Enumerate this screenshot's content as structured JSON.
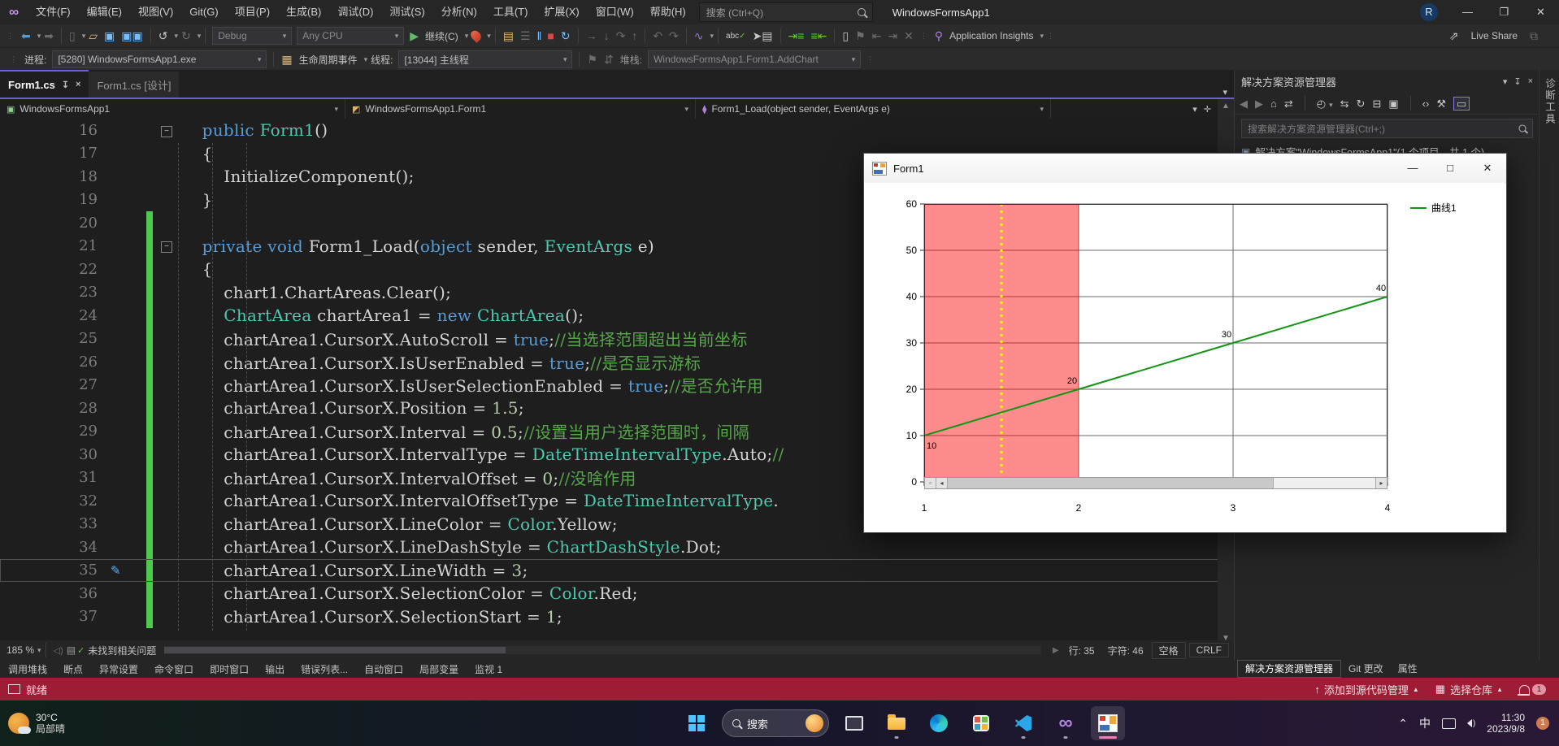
{
  "icons": {
    "grip": "⋮⋮",
    "back": "◀",
    "forward": "▶",
    "caret-down": "▾",
    "caret-up": "▲",
    "new-file": "▯",
    "open-folder": "▱",
    "save": "▭",
    "save-all": "▭▭",
    "undo": "↺",
    "redo": "↻",
    "play": "▶",
    "pause": "‖",
    "stop": "■",
    "restart": "↻",
    "step-over": "↷",
    "step-into": "↓",
    "step-out": "↑",
    "chart": "∿",
    "abc": "abc",
    "pointer": "➤",
    "indent": "⇥",
    "outdent": "⇤",
    "bookmark": "⚑",
    "bulb": "⚲",
    "home": "⌂",
    "sync": "⇄",
    "clock": "◴",
    "swap": "⇆",
    "refresh": "↻",
    "collapse": "⊟",
    "copy-docs": "▣",
    "code-brackets": "‹›",
    "wrench": "⚒",
    "scope": "▭",
    "pin": "↧",
    "close": "×",
    "minimize": "—",
    "maximize": "□",
    "restore": "❐",
    "split": "✛",
    "more": "⋮",
    "dots": "…",
    "fold-minus": "−",
    "pen": "✎",
    "up-arrow": "↑",
    "repo": "▦",
    "flag": "⚑",
    "list": "≣",
    "speaker": "◁)",
    "doc": "▤",
    "check": "✓",
    "left-small": "◂",
    "right-small": "▸",
    "reset-zoom": "▫",
    "chevron-up": "⌃",
    "ime": "中"
  },
  "titlebar": {
    "menus": [
      "文件(F)",
      "编辑(E)",
      "视图(V)",
      "Git(G)",
      "项目(P)",
      "生成(B)",
      "调试(D)",
      "测试(S)",
      "分析(N)",
      "工具(T)",
      "扩展(X)",
      "窗口(W)",
      "帮助(H)"
    ],
    "search_placeholder": "搜索 (Ctrl+Q)",
    "app_title": "WindowsFormsApp1",
    "avatar": "R",
    "minimize": "—",
    "restore": "❐",
    "close": "✕"
  },
  "toolbar": {
    "config": "Debug",
    "platform": "Any CPU",
    "continue_label": "继续(C)",
    "appinsights_label": "Application Insights"
  },
  "debugbar": {
    "process_label": "进程:",
    "process_value": "[5280] WindowsFormsApp1.exe",
    "lifecycle_label": "生命周期事件",
    "thread_label": "线程:",
    "thread_value": "[13044] 主线程",
    "stack_label": "堆栈:",
    "stack_value": "WindowsFormsApp1.Form1.AddChart"
  },
  "tabs": [
    {
      "label": "Form1.cs",
      "active": true
    },
    {
      "label": "Form1.cs [设计]",
      "active": false
    }
  ],
  "navbar": {
    "project": "WindowsFormsApp1",
    "type": "WindowsFormsApp1.Form1",
    "member": "Form1_Load(object sender, EventArgs e)"
  },
  "code": {
    "lines": [
      {
        "n": 16,
        "fold": true,
        "chg": false,
        "tokens": [
          [
            "p",
            "    "
          ],
          [
            "k",
            "public"
          ],
          [
            "p",
            " "
          ],
          [
            "t",
            "Form1"
          ],
          [
            "p",
            "()"
          ]
        ]
      },
      {
        "n": 17,
        "tokens": [
          [
            "p",
            "    {"
          ]
        ]
      },
      {
        "n": 18,
        "tokens": [
          [
            "p",
            "        InitializeComponent();"
          ]
        ]
      },
      {
        "n": 19,
        "tokens": [
          [
            "p",
            "    }"
          ]
        ]
      },
      {
        "n": 20,
        "chg": true,
        "tokens": []
      },
      {
        "n": 21,
        "fold": true,
        "chg": true,
        "tokens": [
          [
            "p",
            "    "
          ],
          [
            "k",
            "private"
          ],
          [
            "p",
            " "
          ],
          [
            "k",
            "void"
          ],
          [
            "p",
            " Form1_Load("
          ],
          [
            "k",
            "object"
          ],
          [
            "p",
            " sender, "
          ],
          [
            "t",
            "EventArgs"
          ],
          [
            "p",
            " e)"
          ]
        ]
      },
      {
        "n": 22,
        "chg": true,
        "tokens": [
          [
            "p",
            "    {"
          ]
        ]
      },
      {
        "n": 23,
        "chg": true,
        "tokens": [
          [
            "p",
            "        chart1.ChartAreas.Clear();"
          ]
        ]
      },
      {
        "n": 24,
        "chg": true,
        "tokens": [
          [
            "p",
            "        "
          ],
          [
            "t",
            "ChartArea"
          ],
          [
            "p",
            " chartArea1 = "
          ],
          [
            "k",
            "new"
          ],
          [
            "p",
            " "
          ],
          [
            "t",
            "ChartArea"
          ],
          [
            "p",
            "();"
          ]
        ]
      },
      {
        "n": 25,
        "chg": true,
        "tokens": [
          [
            "p",
            "        chartArea1.CursorX.AutoScroll = "
          ],
          [
            "k",
            "true"
          ],
          [
            "p",
            ";"
          ],
          [
            "c",
            "//当选择范围超出当前坐标"
          ]
        ]
      },
      {
        "n": 26,
        "chg": true,
        "tokens": [
          [
            "p",
            "        chartArea1.CursorX.IsUserEnabled = "
          ],
          [
            "k",
            "true"
          ],
          [
            "p",
            ";"
          ],
          [
            "c",
            "//是否显示游标"
          ]
        ]
      },
      {
        "n": 27,
        "chg": true,
        "tokens": [
          [
            "p",
            "        chartArea1.CursorX.IsUserSelectionEnabled = "
          ],
          [
            "k",
            "true"
          ],
          [
            "p",
            ";"
          ],
          [
            "c",
            "//是否允许用"
          ]
        ]
      },
      {
        "n": 28,
        "chg": true,
        "tokens": [
          [
            "p",
            "        chartArea1.CursorX.Position = "
          ],
          [
            "n",
            "1.5"
          ],
          [
            "p",
            ";"
          ]
        ]
      },
      {
        "n": 29,
        "chg": true,
        "tokens": [
          [
            "p",
            "        chartArea1.CursorX.Interval = "
          ],
          [
            "n",
            "0.5"
          ],
          [
            "p",
            ";"
          ],
          [
            "c",
            "//设置当用户选择范围时，间隔"
          ]
        ]
      },
      {
        "n": 30,
        "chg": true,
        "tokens": [
          [
            "p",
            "        chartArea1.CursorX.IntervalType = "
          ],
          [
            "t",
            "DateTimeIntervalType"
          ],
          [
            "p",
            ".Auto;"
          ],
          [
            "c",
            "//"
          ]
        ]
      },
      {
        "n": 31,
        "chg": true,
        "tokens": [
          [
            "p",
            "        chartArea1.CursorX.IntervalOffset = "
          ],
          [
            "n",
            "0"
          ],
          [
            "p",
            ";"
          ],
          [
            "c",
            "//没啥作用"
          ]
        ]
      },
      {
        "n": 32,
        "chg": true,
        "tokens": [
          [
            "p",
            "        chartArea1.CursorX.IntervalOffsetType = "
          ],
          [
            "t",
            "DateTimeIntervalType"
          ],
          [
            "p",
            "."
          ]
        ]
      },
      {
        "n": 33,
        "chg": true,
        "tokens": [
          [
            "p",
            "        chartArea1.CursorX.LineColor = "
          ],
          [
            "t",
            "Color"
          ],
          [
            "p",
            ".Yellow;"
          ]
        ]
      },
      {
        "n": 34,
        "chg": true,
        "tokens": [
          [
            "p",
            "        chartArea1.CursorX.LineDashStyle = "
          ],
          [
            "t",
            "ChartDashStyle"
          ],
          [
            "p",
            ".Dot;"
          ]
        ]
      },
      {
        "n": 35,
        "chg": true,
        "cur": true,
        "pen": true,
        "tokens": [
          [
            "p",
            "        chartArea1.CursorX.LineWidth = "
          ],
          [
            "n",
            "3"
          ],
          [
            "p",
            ";"
          ]
        ]
      },
      {
        "n": 36,
        "chg": true,
        "tokens": [
          [
            "p",
            "        chartArea1.CursorX.SelectionColor = "
          ],
          [
            "t",
            "Color"
          ],
          [
            "p",
            ".Red;"
          ]
        ]
      },
      {
        "n": 37,
        "chg": true,
        "tokens": [
          [
            "p",
            "        chartArea1.CursorX.SelectionStart = "
          ],
          [
            "n",
            "1"
          ],
          [
            "p",
            ";"
          ]
        ]
      }
    ]
  },
  "editor_status": {
    "zoom": "185 %",
    "health": "未找到相关问题",
    "line": "行: 35",
    "char": "字符: 46",
    "space": "空格",
    "eol": "CRLF"
  },
  "bottom_tabs": [
    "调用堆栈",
    "断点",
    "异常设置",
    "命令窗口",
    "即时窗口",
    "输出",
    "错误列表...",
    "自动窗口",
    "局部变量",
    "监视 1"
  ],
  "solution_explorer": {
    "title": "解决方案资源管理器",
    "search_placeholder": "搜索解决方案资源管理器(Ctrl+;)",
    "root_item": "解决方案\"WindowsFormsApp1\"(1 个项目，共 1 个)",
    "bottom_tabs": [
      {
        "label": "解决方案资源管理器",
        "active": true
      },
      {
        "label": "Git 更改",
        "active": false
      },
      {
        "label": "属性",
        "active": false
      }
    ]
  },
  "right_strip": {
    "vertical_tab": "诊断工具"
  },
  "statusbar": {
    "ready": "就绪",
    "add_source_control": "添加到源代码管理",
    "select_repo": "选择仓库",
    "bell_badge": "1"
  },
  "form1": {
    "title": "Form1",
    "minimize": "—",
    "maximize": "□",
    "close": "✕"
  },
  "chart_data": {
    "type": "line",
    "title": "",
    "xlabel": "",
    "ylabel": "",
    "xlim": [
      1,
      4
    ],
    "ylim": [
      0,
      60
    ],
    "xticks": [
      1,
      2,
      3,
      4
    ],
    "yticks": [
      0,
      10,
      20,
      30,
      40,
      50,
      60
    ],
    "grid": true,
    "legend_position": "top-right",
    "series": [
      {
        "name": "曲线1",
        "color": "#149414",
        "x": [
          1,
          2,
          3,
          4
        ],
        "y": [
          10,
          20,
          30,
          40
        ],
        "point_labels": [
          "10",
          "20",
          "30",
          "40"
        ]
      }
    ],
    "cursor_x": {
      "position": 1.5,
      "line_color": "#ffff00",
      "style": "dotted",
      "width": 3
    },
    "selection": {
      "start": 1,
      "end": 2,
      "color": "#ff0000",
      "opacity": 0.45
    }
  },
  "taskbar": {
    "weather_temp": "30°C",
    "weather_desc": "局部晴",
    "search_label": "搜索",
    "ime": "中",
    "time": "11:30",
    "date": "2023/9/8",
    "badge": "1"
  }
}
